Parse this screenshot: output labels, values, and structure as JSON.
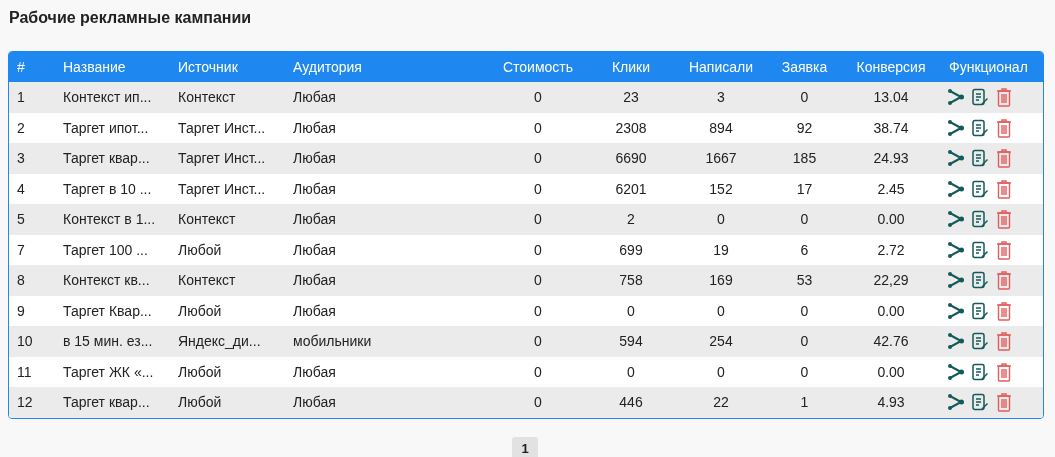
{
  "title": "Рабочие рекламные кампании",
  "table": {
    "columns": [
      "#",
      "Название",
      "Источник",
      "Аудитория",
      "Стоимость",
      "Клики",
      "Написали",
      "Заявка",
      "Конверсия",
      "Функционал"
    ],
    "rows": [
      {
        "cells": [
          "1",
          "Контекст ип...",
          "Контекст",
          "Любая",
          "0",
          "23",
          "3",
          "0",
          "13.04"
        ]
      },
      {
        "cells": [
          "2",
          "Таргет ипот...",
          "Таргет Инст...",
          "Любая",
          "0",
          "2308",
          "894",
          "92",
          "38.74"
        ]
      },
      {
        "cells": [
          "3",
          "Таргет квар...",
          "Таргет Инст...",
          "Любая",
          "0",
          "6690",
          "1667",
          "185",
          "24.93"
        ]
      },
      {
        "cells": [
          "4",
          "Таргет в 10 ...",
          "Таргет Инст...",
          "Любая",
          "0",
          "6201",
          "152",
          "17",
          "2.45"
        ]
      },
      {
        "cells": [
          "5",
          "Контекст в 1...",
          "Контекст",
          "Любая",
          "0",
          "2",
          "0",
          "0",
          "0.00"
        ]
      },
      {
        "cells": [
          "7",
          "Таргет 100 ...",
          "Любой",
          "Любая",
          "0",
          "699",
          "19",
          "6",
          "2.72"
        ]
      },
      {
        "cells": [
          "8",
          "Контекст кв...",
          "Контекст",
          "Любая",
          "0",
          "758",
          "169",
          "53",
          "22,29"
        ]
      },
      {
        "cells": [
          "9",
          "Таргет Квар...",
          "Любой",
          "Любая",
          "0",
          "0",
          "0",
          "0",
          "0.00"
        ]
      },
      {
        "cells": [
          "10",
          "в 15 мин. ез...",
          "Яндекс_ди...",
          "мобильники",
          "0",
          "594",
          "254",
          "0",
          "42.76"
        ]
      },
      {
        "cells": [
          "11",
          "Таргет ЖК «...",
          "Любой",
          "Любая",
          "0",
          "0",
          "0",
          "0",
          "0.00"
        ]
      },
      {
        "cells": [
          "12",
          "Таргет квар...",
          "Любой",
          "Любая",
          "0",
          "446",
          "22",
          "1",
          "4.93"
        ]
      }
    ]
  },
  "pagination": [
    {
      "label": "1",
      "selected": true
    }
  ]
}
